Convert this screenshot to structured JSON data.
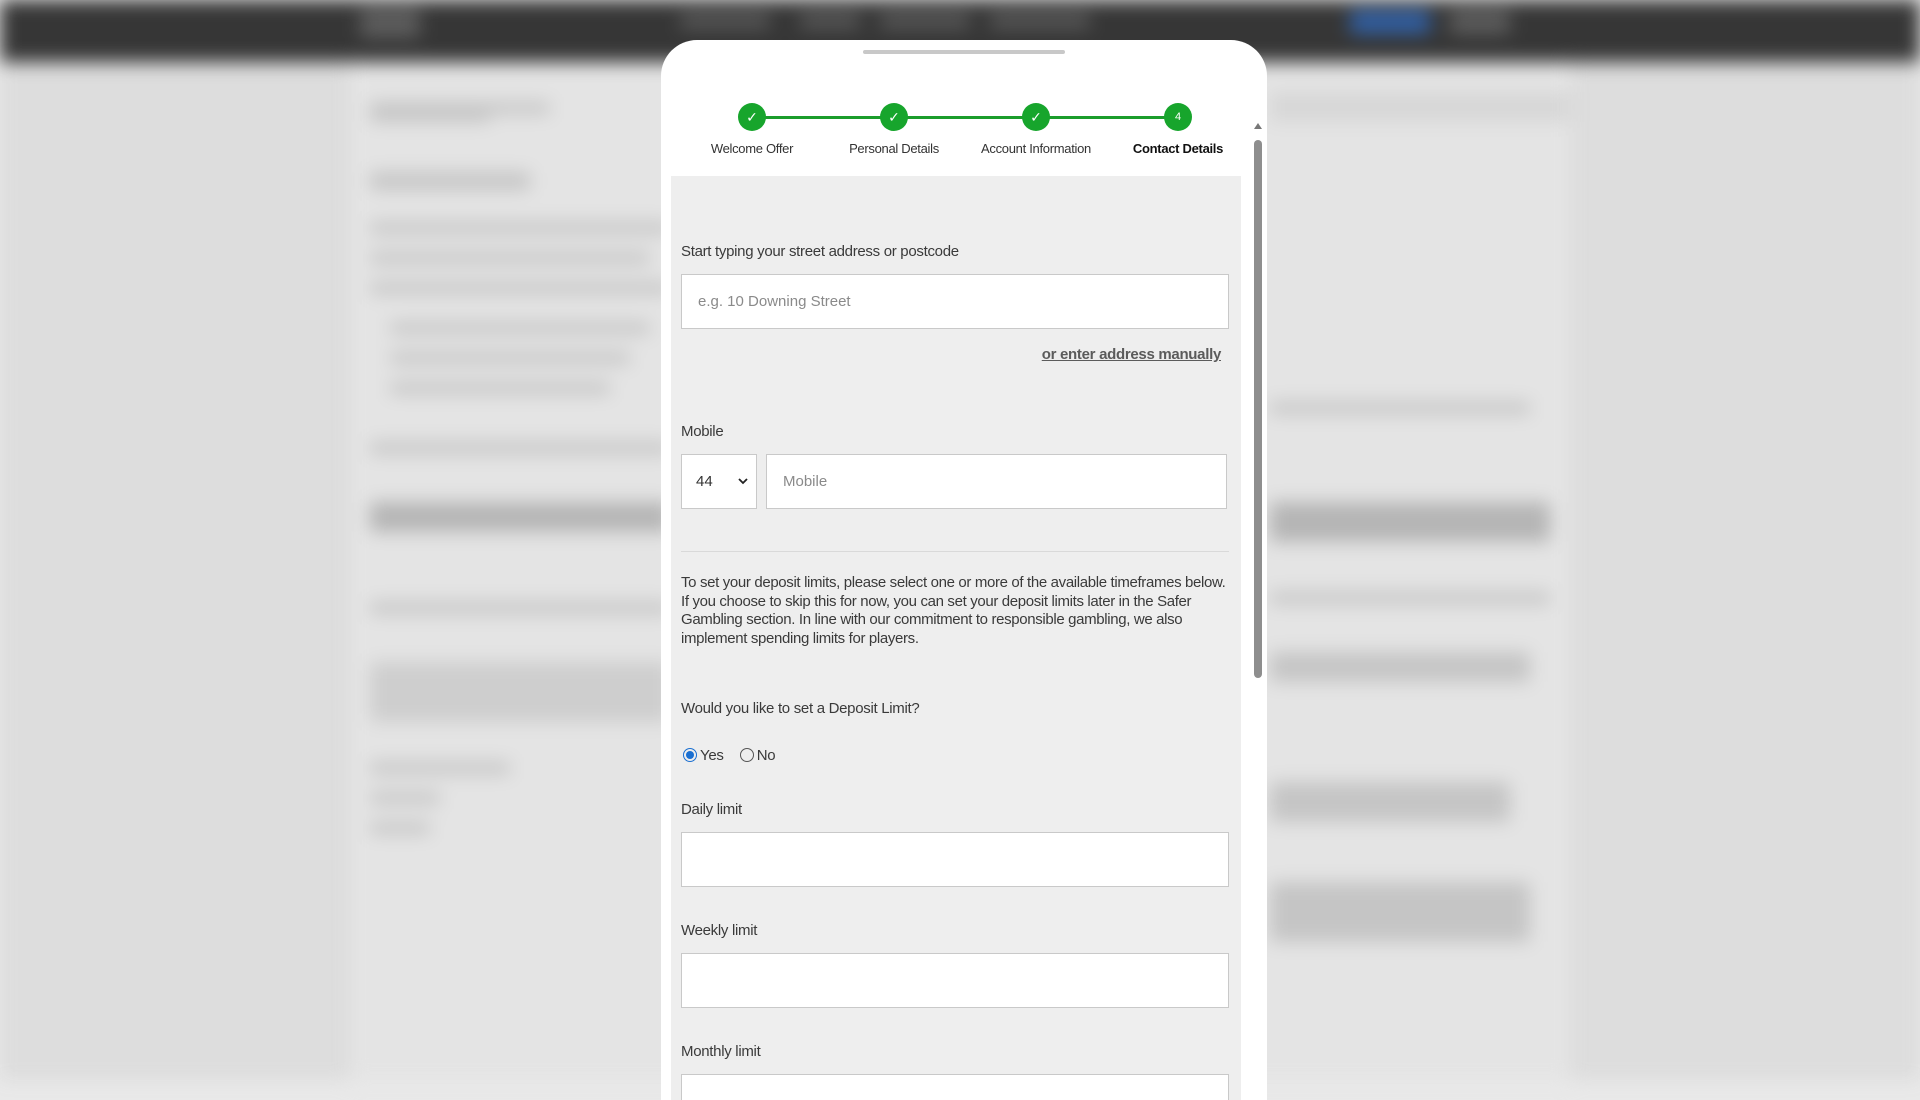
{
  "stepper": {
    "steps": [
      {
        "label": "Welcome Offer",
        "state": "done",
        "mark": "✓"
      },
      {
        "label": "Personal Details",
        "state": "done",
        "mark": "✓"
      },
      {
        "label": "Account Information",
        "state": "done",
        "mark": "✓"
      },
      {
        "label": "Contact Details",
        "state": "active",
        "mark": "4"
      }
    ]
  },
  "address": {
    "label": "Start typing your street address or postcode",
    "placeholder": "e.g. 10 Downing Street",
    "value": "",
    "manual_link": "or enter address manually"
  },
  "mobile": {
    "label": "Mobile",
    "country_code": "44",
    "placeholder": "Mobile",
    "value": ""
  },
  "info_text": "To set your deposit limits, please select one or more of the available timeframes below. If you choose to skip this for now, you can set your deposit limits later in the Safer Gambling section. In line with our commitment to responsible gambling, we also implement spending limits for players.",
  "deposit_limit": {
    "question": "Would you like to set a Deposit Limit?",
    "options": [
      {
        "label": "Yes",
        "checked": true
      },
      {
        "label": "No",
        "checked": false
      }
    ],
    "daily_label": "Daily limit",
    "weekly_label": "Weekly limit",
    "monthly_label": "Monthly limit"
  },
  "colors": {
    "step_green": "#17a52c",
    "radio_blue": "#1a6fd1"
  },
  "icons": {
    "step_done": "check-icon",
    "select": "chevron-down-icon",
    "scroll_up": "triangle-up-icon",
    "scroll_down": "triangle-down-icon"
  }
}
